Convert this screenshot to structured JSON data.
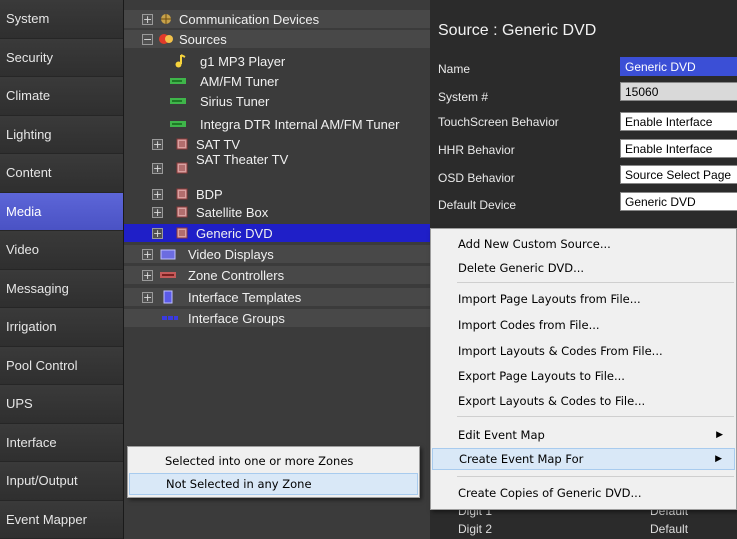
{
  "nav": {
    "items": [
      {
        "label": "System"
      },
      {
        "label": "Security"
      },
      {
        "label": "Climate"
      },
      {
        "label": "Lighting"
      },
      {
        "label": "Content"
      },
      {
        "label": "Media",
        "active": true
      },
      {
        "label": "Video"
      },
      {
        "label": "Messaging"
      },
      {
        "label": "Irrigation"
      },
      {
        "label": "Pool Control"
      },
      {
        "label": "UPS"
      },
      {
        "label": "Interface"
      },
      {
        "label": "Input/Output"
      },
      {
        "label": "Event Mapper"
      }
    ]
  },
  "tree": {
    "communication_devices": "Communication Devices",
    "sources": "Sources",
    "g1_mp3": "g1 MP3 Player",
    "am_fm": "AM/FM Tuner",
    "sirius": "Sirius Tuner",
    "integra": "Integra DTR Internal AM/FM Tuner",
    "sat_tv": "SAT TV",
    "sat_theater": "SAT Theater TV",
    "bdp": "BDP",
    "satellite_box": "Satellite Box",
    "generic_dvd": "Generic DVD",
    "video_displays": "Video Displays",
    "zone_controllers": "Zone Controllers",
    "interface_templates": "Interface Templates",
    "interface_groups": "Interface Groups",
    "expander_plus": "+",
    "expander_minus": "−"
  },
  "props": {
    "title": "Source : Generic DVD",
    "name_label": "Name",
    "name_value": "Generic DVD",
    "system_label": "System #",
    "system_value": "15060",
    "touch_label": "TouchScreen Behavior",
    "touch_value": "Enable Interface",
    "hhr_label": "HHR Behavior",
    "hhr_value": "Enable Interface",
    "osd_label": "OSD Behavior",
    "osd_value": "Source Select Page",
    "default_label": "Default Device",
    "default_value": "Generic DVD",
    "digit1_label": "Digit 1",
    "digit1_value": "Default",
    "digit2_label": "Digit 2",
    "digit2_value": "Default"
  },
  "context_menu": {
    "items": [
      "Add New Custom Source...",
      "Delete Generic DVD...",
      "Import Page Layouts from File...",
      "Import Codes from File...",
      "Import Layouts & Codes From File...",
      "Export Page Layouts to File...",
      "Export Layouts & Codes to File...",
      "Edit Event Map",
      "Create Event Map For",
      "Create Copies of Generic DVD..."
    ],
    "submenu_arrow": "▶"
  },
  "submenu": {
    "items": [
      "Selected into one or more Zones",
      "Not Selected in any Zone"
    ]
  },
  "colors": {
    "accent": "#4a52c4",
    "selection": "#1f1fc8"
  }
}
